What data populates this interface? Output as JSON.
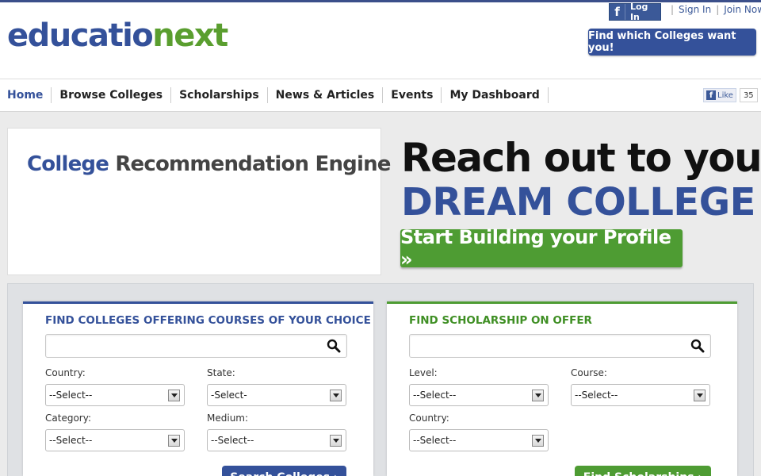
{
  "brand": {
    "logo_part1": "educatio",
    "logo_part2": "next"
  },
  "topbar": {
    "fb_login_label": "Log In",
    "sign_in": "Sign In",
    "join_now": "Join Now",
    "find_colleges_button": "Find which Colleges want you!"
  },
  "nav": {
    "items": [
      "Home",
      "Browse Colleges",
      "Scholarships",
      "News & Articles",
      "Events",
      "My Dashboard"
    ],
    "fb_like_label": "Like",
    "fb_like_count": "35"
  },
  "hero": {
    "engine_part1": "College",
    "engine_part2": "Recommendation Engine",
    "headline_1": "Reach out to your",
    "headline_2": "DREAM COLLEGE",
    "cta": "Start Building your Profile »"
  },
  "colleges_panel": {
    "title": "FIND COLLEGES OFFERING COURSES OF YOUR CHOICE",
    "search_value": "",
    "country_label": "Country:",
    "country_value": "--Select--",
    "state_label": "State:",
    "state_value": "-Select-",
    "category_label": "Category:",
    "category_value": "--Select--",
    "medium_label": "Medium:",
    "medium_value": "--Select--",
    "button": "Search Colleges ›"
  },
  "scholarship_panel": {
    "title": "FIND SCHOLARSHIP ON OFFER",
    "search_value": "",
    "level_label": "Level:",
    "level_value": "--Select--",
    "course_label": "Course:",
    "course_value": "--Select--",
    "country_label": "Country:",
    "country_value": "--Select--",
    "button": "Find Scholarships ›"
  },
  "colors": {
    "brand_blue": "#34519a",
    "brand_green": "#4e9c33",
    "facebook_blue": "#3b5998"
  }
}
